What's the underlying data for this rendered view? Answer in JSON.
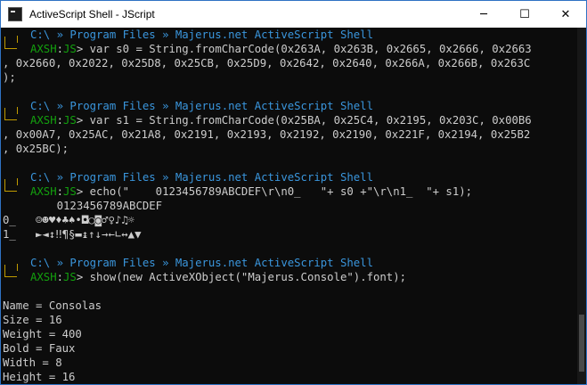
{
  "window": {
    "title": "ActiveScript Shell - JScript"
  },
  "controls": {
    "minimize": "─",
    "maximize": "☐",
    "close": "✕"
  },
  "prompt": {
    "path": "C:\\ » Program Files » Majerus.net ActiveScript Shell",
    "name": "AXSH",
    "lang": "JS",
    "marker": ">"
  },
  "lines": {
    "c1a": " var s0 = String.fromCharCode(0x263A, 0x263B, 0x2665, 0x2666, 0x2663",
    "c1b": ", 0x2660, 0x2022, 0x25D8, 0x25CB, 0x25D9, 0x2642, 0x2640, 0x266A, 0x266B, 0x263C",
    "c1c": ");",
    "c2a": " var s1 = String.fromCharCode(0x25BA, 0x25C4, 0x2195, 0x203C, 0x00B6",
    "c2b": ", 0x00A7, 0x25AC, 0x21A8, 0x2191, 0x2193, 0x2192, 0x2190, 0x221F, 0x2194, 0x25B2",
    "c2c": ", 0x25BC);",
    "c3a": " echo(\"    0123456789ABCDEF\\r\\n0_   \"+ s0 +\"\\r\\n1_  \"+ s1);",
    "o3a": "    0123456789ABCDEF",
    "o3b": "0_   ☺☻♥♦♣♠•◘○◙♂♀♪♫☼",
    "o3c": "1_   ►◄↕‼¶§▬↨↑↓→←∟↔▲▼",
    "c4a": " show(new ActiveXObject(\"Majerus.Console\").font);",
    "o4a": "Name = Consolas",
    "o4b": "Size = 16",
    "o4c": "Weight = 400",
    "o4d": "Bold = Faux",
    "o4e": "Width = 8",
    "o4f": "Height = 16"
  }
}
